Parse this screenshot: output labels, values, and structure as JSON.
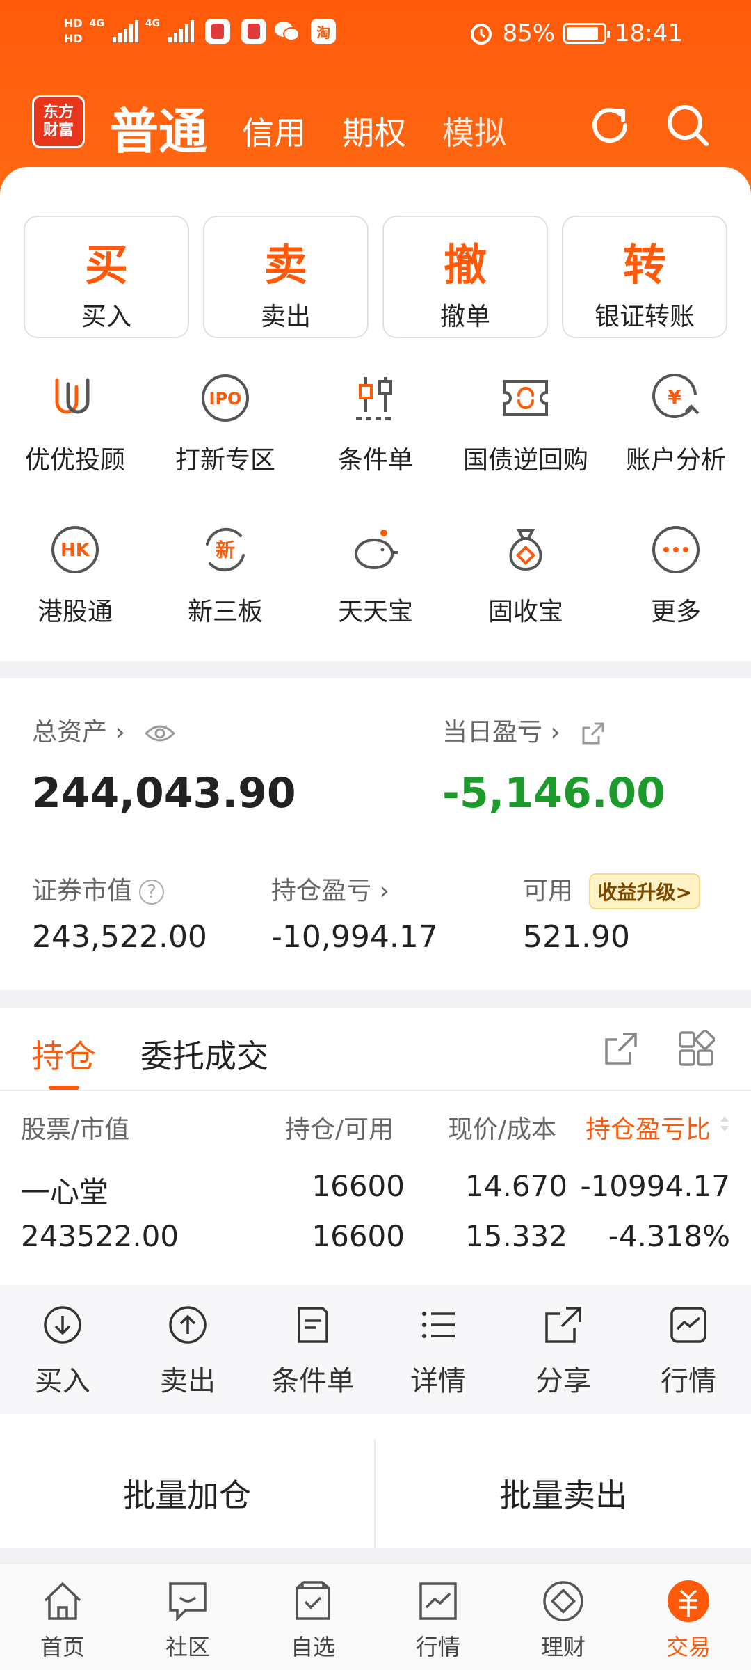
{
  "status_bar": {
    "time": "18:41",
    "battery": "85%",
    "net1": "4G",
    "net2": "4G",
    "hd1": "HD",
    "hd2": "HD"
  },
  "header": {
    "logo_line1": "东方",
    "logo_line2": "财富",
    "tabs": [
      "普通",
      "信用",
      "期权",
      "模拟"
    ],
    "active_tab": "普通"
  },
  "quick_actions": [
    {
      "big": "买",
      "label": "买入"
    },
    {
      "big": "卖",
      "label": "卖出"
    },
    {
      "big": "撤",
      "label": "撤单"
    },
    {
      "big": "转",
      "label": "银证转账"
    }
  ],
  "features": [
    {
      "label": "优优投顾",
      "icon": "uu-advisor-icon"
    },
    {
      "label": "打新专区",
      "icon": "ipo-icon"
    },
    {
      "label": "条件单",
      "icon": "candlestick-icon"
    },
    {
      "label": "国债逆回购",
      "icon": "repo-ticket-icon"
    },
    {
      "label": "账户分析",
      "icon": "yen-chart-icon"
    },
    {
      "label": "港股通",
      "icon": "hk-icon"
    },
    {
      "label": "新三板",
      "icon": "new-board-icon"
    },
    {
      "label": "天天宝",
      "icon": "piggy-bank-icon"
    },
    {
      "label": "固收宝",
      "icon": "money-bag-icon"
    },
    {
      "label": "更多",
      "icon": "more-icon"
    }
  ],
  "assets": {
    "total_label": "总资产",
    "total_value": "244,043.90",
    "daily_pl_label": "当日盈亏",
    "daily_pl_value": "-5,146.00",
    "market_value_label": "证券市值",
    "market_value": "243,522.00",
    "position_pl_label": "持仓盈亏",
    "position_pl": "-10,994.17",
    "available_label": "可用",
    "available_value": "521.90",
    "upgrade_badge": "收益升级>"
  },
  "holdings": {
    "tab_positions": "持仓",
    "tab_orders": "委托成交",
    "columns": [
      "股票/市值",
      "持仓/可用",
      "现价/成本",
      "持仓盈亏比"
    ],
    "rows": [
      {
        "name": "一心堂",
        "market_value": "243522.00",
        "position": "16600",
        "available": "16600",
        "price": "14.670",
        "cost": "15.332",
        "pl": "-10994.17",
        "pl_ratio": "-4.318%"
      }
    ],
    "actions": [
      "买入",
      "卖出",
      "条件单",
      "详情",
      "分享",
      "行情"
    ],
    "batch_add": "批量加仓",
    "batch_sell": "批量卖出"
  },
  "bottom_nav": [
    {
      "label": "首页",
      "icon": "home-icon"
    },
    {
      "label": "社区",
      "icon": "community-icon"
    },
    {
      "label": "自选",
      "icon": "watchlist-icon"
    },
    {
      "label": "行情",
      "icon": "market-icon"
    },
    {
      "label": "理财",
      "icon": "wealth-icon"
    },
    {
      "label": "交易",
      "icon": "trade-icon"
    }
  ],
  "colors": {
    "brand": "#ff5a0a",
    "loss_green": "#1c9b2c"
  }
}
